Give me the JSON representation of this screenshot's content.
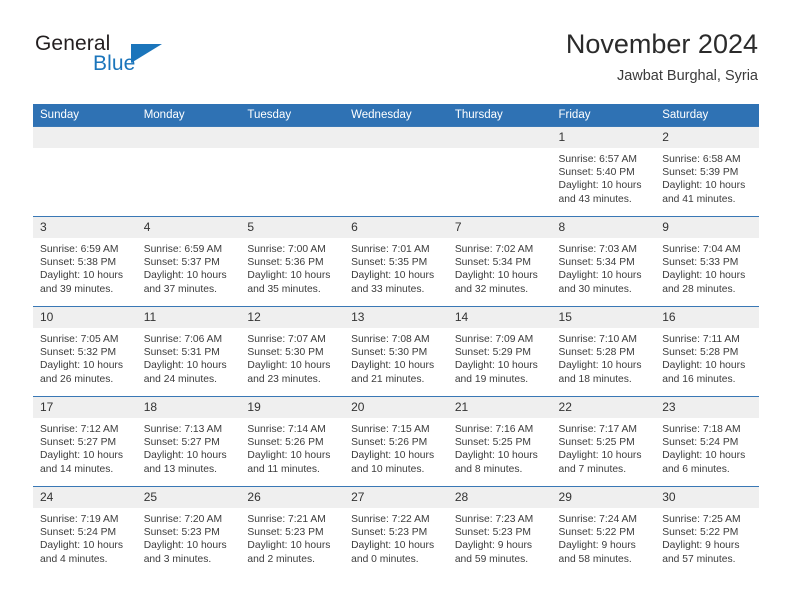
{
  "logo": {
    "word_one": "General",
    "word_two": "Blue",
    "triangle": "blue-triangle",
    "accent_color": "#1b75bb"
  },
  "header": {
    "title": "November 2024",
    "subtitle": "Jawbat Burghal, Syria"
  },
  "colors": {
    "header_bar": "#2f72b4",
    "daynum_band": "#efefef",
    "row_border": "#3a78b5",
    "text": "#3c3c3c"
  },
  "weekdays": [
    "Sunday",
    "Monday",
    "Tuesday",
    "Wednesday",
    "Thursday",
    "Friday",
    "Saturday"
  ],
  "labels": {
    "sunrise_prefix": "Sunrise:",
    "sunset_prefix": "Sunset:",
    "daylight_prefix": "Daylight:"
  },
  "weeks": [
    [
      {
        "day": "",
        "empty": true
      },
      {
        "day": "",
        "empty": true
      },
      {
        "day": "",
        "empty": true
      },
      {
        "day": "",
        "empty": true
      },
      {
        "day": "",
        "empty": true
      },
      {
        "day": "1",
        "sunrise": "Sunrise: 6:57 AM",
        "sunset": "Sunset: 5:40 PM",
        "daylight": "Daylight: 10 hours and 43 minutes."
      },
      {
        "day": "2",
        "sunrise": "Sunrise: 6:58 AM",
        "sunset": "Sunset: 5:39 PM",
        "daylight": "Daylight: 10 hours and 41 minutes."
      }
    ],
    [
      {
        "day": "3",
        "sunrise": "Sunrise: 6:59 AM",
        "sunset": "Sunset: 5:38 PM",
        "daylight": "Daylight: 10 hours and 39 minutes."
      },
      {
        "day": "4",
        "sunrise": "Sunrise: 6:59 AM",
        "sunset": "Sunset: 5:37 PM",
        "daylight": "Daylight: 10 hours and 37 minutes."
      },
      {
        "day": "5",
        "sunrise": "Sunrise: 7:00 AM",
        "sunset": "Sunset: 5:36 PM",
        "daylight": "Daylight: 10 hours and 35 minutes."
      },
      {
        "day": "6",
        "sunrise": "Sunrise: 7:01 AM",
        "sunset": "Sunset: 5:35 PM",
        "daylight": "Daylight: 10 hours and 33 minutes."
      },
      {
        "day": "7",
        "sunrise": "Sunrise: 7:02 AM",
        "sunset": "Sunset: 5:34 PM",
        "daylight": "Daylight: 10 hours and 32 minutes."
      },
      {
        "day": "8",
        "sunrise": "Sunrise: 7:03 AM",
        "sunset": "Sunset: 5:34 PM",
        "daylight": "Daylight: 10 hours and 30 minutes."
      },
      {
        "day": "9",
        "sunrise": "Sunrise: 7:04 AM",
        "sunset": "Sunset: 5:33 PM",
        "daylight": "Daylight: 10 hours and 28 minutes."
      }
    ],
    [
      {
        "day": "10",
        "sunrise": "Sunrise: 7:05 AM",
        "sunset": "Sunset: 5:32 PM",
        "daylight": "Daylight: 10 hours and 26 minutes."
      },
      {
        "day": "11",
        "sunrise": "Sunrise: 7:06 AM",
        "sunset": "Sunset: 5:31 PM",
        "daylight": "Daylight: 10 hours and 24 minutes."
      },
      {
        "day": "12",
        "sunrise": "Sunrise: 7:07 AM",
        "sunset": "Sunset: 5:30 PM",
        "daylight": "Daylight: 10 hours and 23 minutes."
      },
      {
        "day": "13",
        "sunrise": "Sunrise: 7:08 AM",
        "sunset": "Sunset: 5:30 PM",
        "daylight": "Daylight: 10 hours and 21 minutes."
      },
      {
        "day": "14",
        "sunrise": "Sunrise: 7:09 AM",
        "sunset": "Sunset: 5:29 PM",
        "daylight": "Daylight: 10 hours and 19 minutes."
      },
      {
        "day": "15",
        "sunrise": "Sunrise: 7:10 AM",
        "sunset": "Sunset: 5:28 PM",
        "daylight": "Daylight: 10 hours and 18 minutes."
      },
      {
        "day": "16",
        "sunrise": "Sunrise: 7:11 AM",
        "sunset": "Sunset: 5:28 PM",
        "daylight": "Daylight: 10 hours and 16 minutes."
      }
    ],
    [
      {
        "day": "17",
        "sunrise": "Sunrise: 7:12 AM",
        "sunset": "Sunset: 5:27 PM",
        "daylight": "Daylight: 10 hours and 14 minutes."
      },
      {
        "day": "18",
        "sunrise": "Sunrise: 7:13 AM",
        "sunset": "Sunset: 5:27 PM",
        "daylight": "Daylight: 10 hours and 13 minutes."
      },
      {
        "day": "19",
        "sunrise": "Sunrise: 7:14 AM",
        "sunset": "Sunset: 5:26 PM",
        "daylight": "Daylight: 10 hours and 11 minutes."
      },
      {
        "day": "20",
        "sunrise": "Sunrise: 7:15 AM",
        "sunset": "Sunset: 5:26 PM",
        "daylight": "Daylight: 10 hours and 10 minutes."
      },
      {
        "day": "21",
        "sunrise": "Sunrise: 7:16 AM",
        "sunset": "Sunset: 5:25 PM",
        "daylight": "Daylight: 10 hours and 8 minutes."
      },
      {
        "day": "22",
        "sunrise": "Sunrise: 7:17 AM",
        "sunset": "Sunset: 5:25 PM",
        "daylight": "Daylight: 10 hours and 7 minutes."
      },
      {
        "day": "23",
        "sunrise": "Sunrise: 7:18 AM",
        "sunset": "Sunset: 5:24 PM",
        "daylight": "Daylight: 10 hours and 6 minutes."
      }
    ],
    [
      {
        "day": "24",
        "sunrise": "Sunrise: 7:19 AM",
        "sunset": "Sunset: 5:24 PM",
        "daylight": "Daylight: 10 hours and 4 minutes."
      },
      {
        "day": "25",
        "sunrise": "Sunrise: 7:20 AM",
        "sunset": "Sunset: 5:23 PM",
        "daylight": "Daylight: 10 hours and 3 minutes."
      },
      {
        "day": "26",
        "sunrise": "Sunrise: 7:21 AM",
        "sunset": "Sunset: 5:23 PM",
        "daylight": "Daylight: 10 hours and 2 minutes."
      },
      {
        "day": "27",
        "sunrise": "Sunrise: 7:22 AM",
        "sunset": "Sunset: 5:23 PM",
        "daylight": "Daylight: 10 hours and 0 minutes."
      },
      {
        "day": "28",
        "sunrise": "Sunrise: 7:23 AM",
        "sunset": "Sunset: 5:23 PM",
        "daylight": "Daylight: 9 hours and 59 minutes."
      },
      {
        "day": "29",
        "sunrise": "Sunrise: 7:24 AM",
        "sunset": "Sunset: 5:22 PM",
        "daylight": "Daylight: 9 hours and 58 minutes."
      },
      {
        "day": "30",
        "sunrise": "Sunrise: 7:25 AM",
        "sunset": "Sunset: 5:22 PM",
        "daylight": "Daylight: 9 hours and 57 minutes."
      }
    ]
  ]
}
